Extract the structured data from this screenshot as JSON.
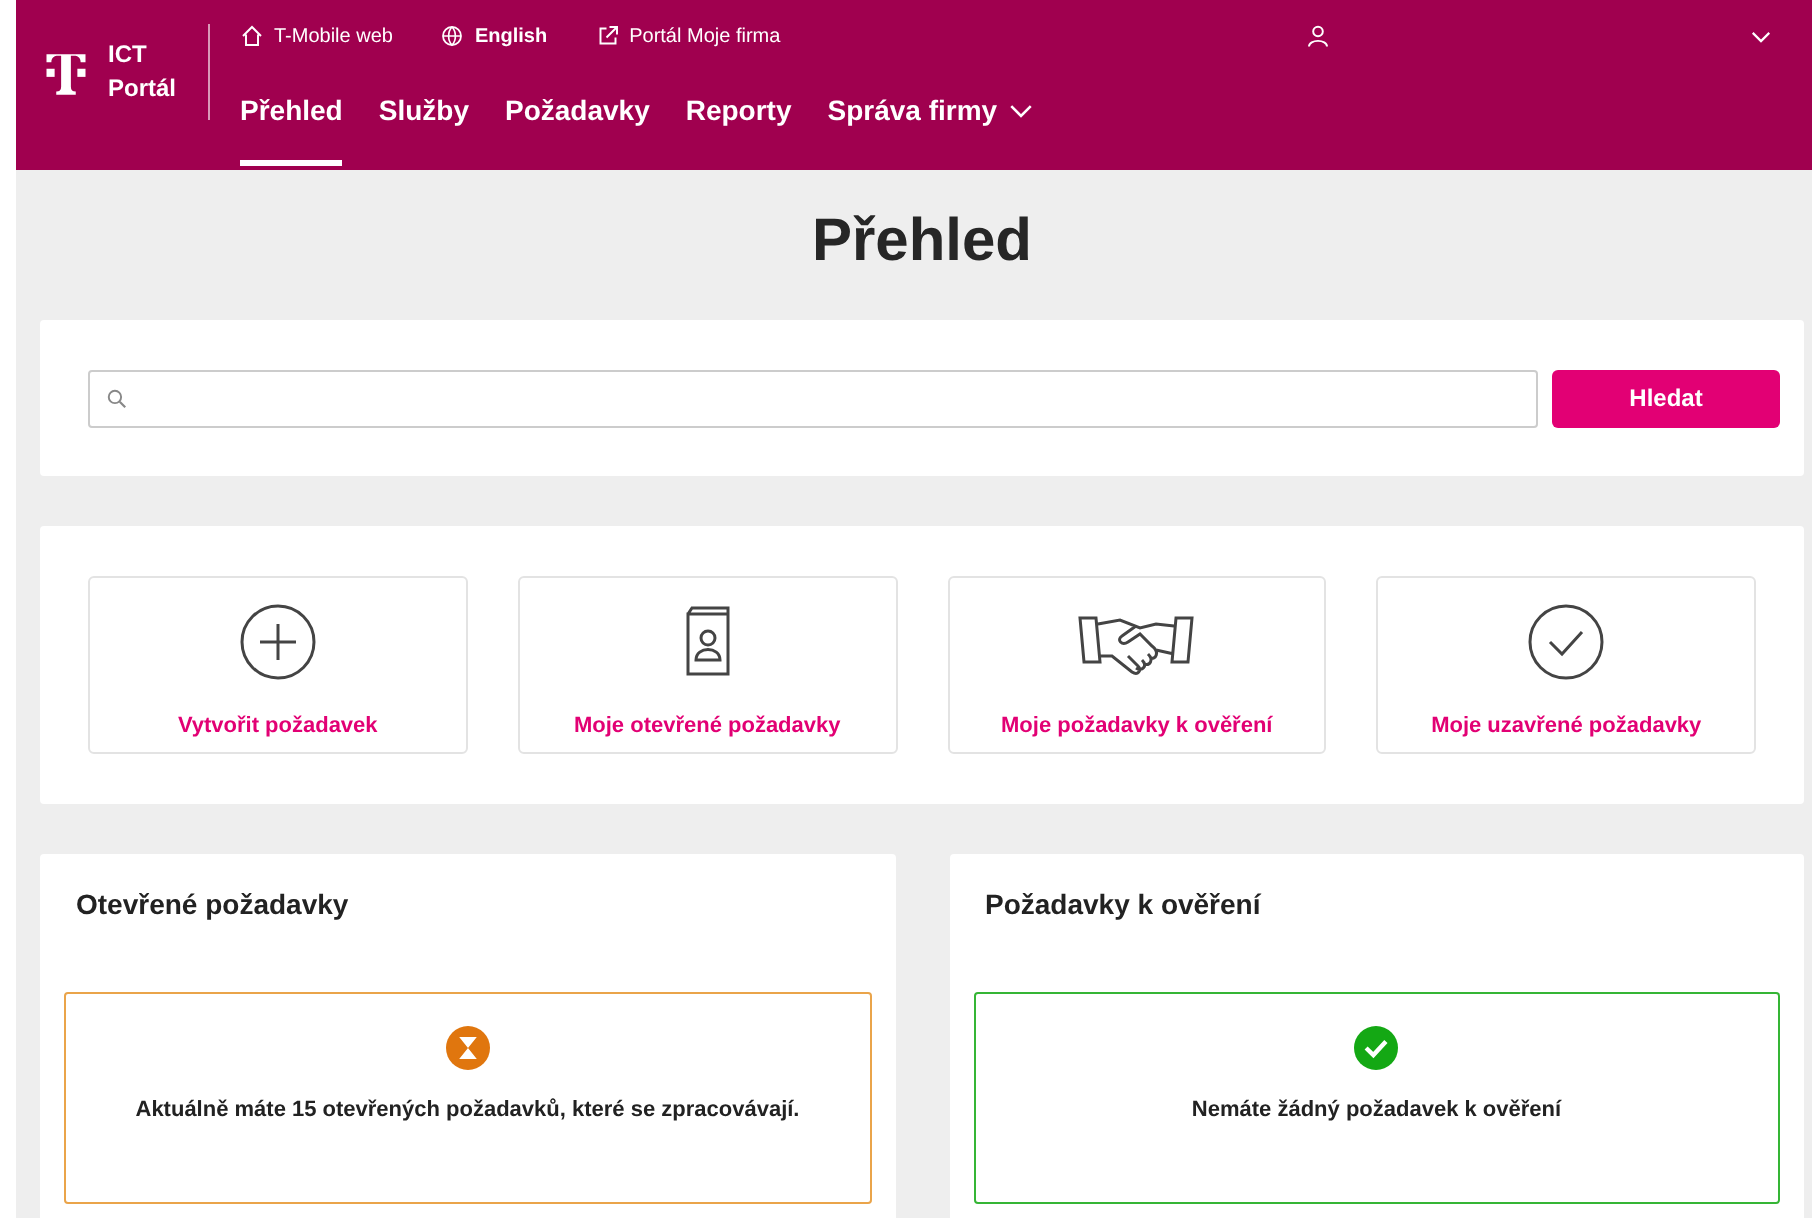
{
  "header": {
    "logo": "ICT Portál",
    "top_links": [
      {
        "kind": "home",
        "label": "T-Mobile web",
        "bold": false
      },
      {
        "kind": "globe",
        "label": "English",
        "bold": true
      },
      {
        "kind": "external",
        "label": "Portál Moje firma",
        "bold": false
      }
    ],
    "nav": [
      {
        "label": "Přehled",
        "selected": true,
        "dropdown": false
      },
      {
        "label": "Služby",
        "selected": false,
        "dropdown": false
      },
      {
        "label": "Požadavky",
        "selected": false,
        "dropdown": false
      },
      {
        "label": "Reporty",
        "selected": false,
        "dropdown": false
      },
      {
        "label": "Správa firmy",
        "selected": false,
        "dropdown": true
      }
    ]
  },
  "page_title": "Přehled",
  "search": {
    "button": "Hledat"
  },
  "tiles": [
    {
      "kind": "plus",
      "label": "Vytvořit požadavek"
    },
    {
      "kind": "book",
      "label": "Moje otevřené požadavky"
    },
    {
      "kind": "handshake",
      "label": "Moje požadavky k ověření"
    },
    {
      "kind": "check",
      "label": "Moje uzavřené požadavky"
    }
  ],
  "panels": [
    {
      "title": "Otevřené požadavky",
      "status": {
        "kind": "warning",
        "message": "Aktuálně máte 15 otevřených požadavků, které se zpracovávají."
      }
    },
    {
      "title": "Požadavky k ověření",
      "status": {
        "kind": "success",
        "message": "Nemáte žádný požadavek k ověření"
      }
    }
  ]
}
